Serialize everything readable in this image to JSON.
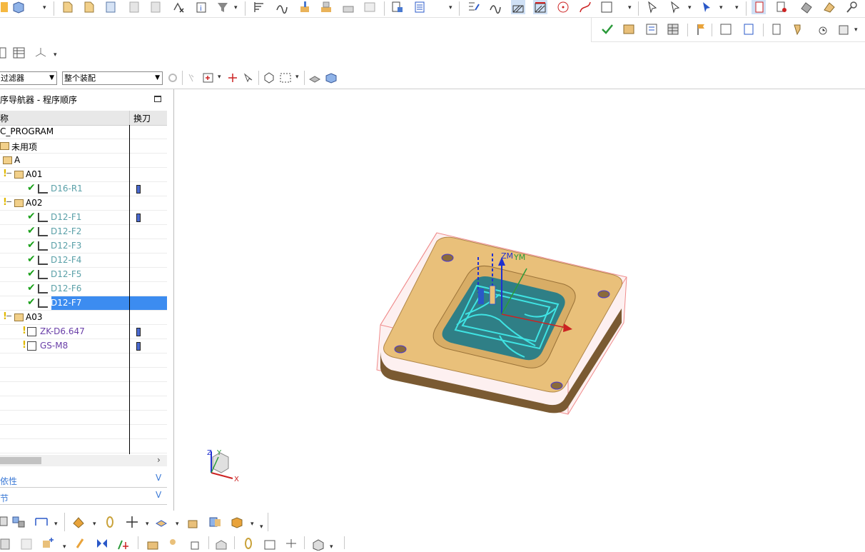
{
  "filter": {
    "type_filter": "过滤器",
    "scope_filter": "整个装配"
  },
  "navigator": {
    "title": "序导航器 - 程序顺序",
    "columns": [
      "称",
      "换刀"
    ],
    "rows": [
      {
        "label": "C_PROGRAM",
        "kind": "root"
      },
      {
        "label": "未用项",
        "kind": "folder"
      },
      {
        "label": "A",
        "kind": "group"
      },
      {
        "label": "A01",
        "kind": "group"
      },
      {
        "label": "D16-R1",
        "kind": "op",
        "tool_change": true
      },
      {
        "label": "A02",
        "kind": "group"
      },
      {
        "label": "D12-F1",
        "kind": "op",
        "tool_change": true
      },
      {
        "label": "D12-F2",
        "kind": "op"
      },
      {
        "label": "D12-F3",
        "kind": "op"
      },
      {
        "label": "D12-F4",
        "kind": "op"
      },
      {
        "label": "D12-F5",
        "kind": "op"
      },
      {
        "label": "D12-F6",
        "kind": "op"
      },
      {
        "label": "D12-F7",
        "kind": "op",
        "selected": true
      },
      {
        "label": "A03",
        "kind": "group"
      },
      {
        "label": "ZK-D6.647",
        "kind": "op-pending",
        "tool_change": true
      },
      {
        "label": "GS-M8",
        "kind": "op-pending",
        "tool_change": true
      }
    ]
  },
  "panels": {
    "dependencies": "依性",
    "details": "节"
  },
  "viewport": {
    "wcs_z_label": "ZM",
    "wcs_y_label": "YM",
    "triad_z": "Z",
    "triad_y": "Y",
    "triad_x": "X"
  },
  "colors": {
    "accent": "#3c8cf0",
    "op_text": "#5aa0a8",
    "pending_text": "#6a3fa8",
    "part_top": "#e9c07a",
    "part_side": "#7a5a32",
    "toolpath": "#3fe3e3",
    "blank_box": "#f08c8c"
  }
}
